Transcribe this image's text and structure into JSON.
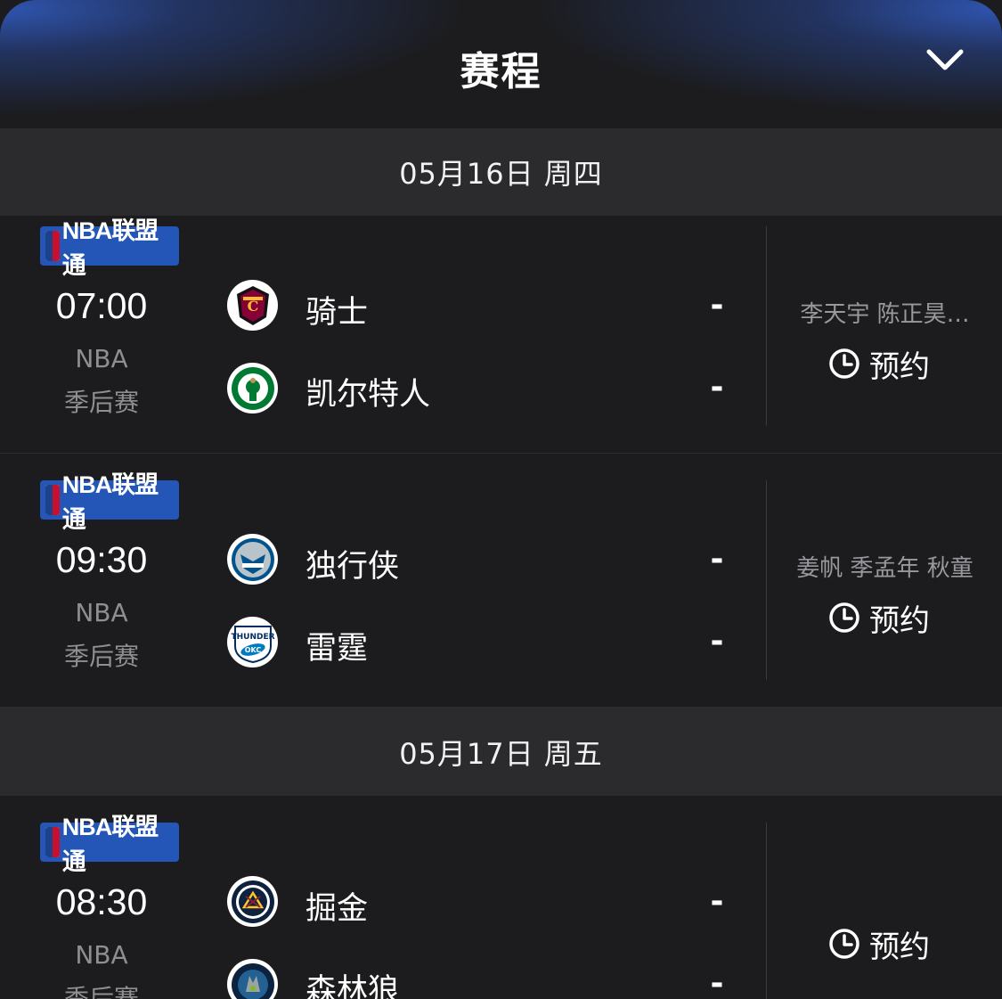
{
  "header": {
    "title": "赛程"
  },
  "days": [
    {
      "date": "05月16日 周四",
      "matches": [
        {
          "badge": "NBA联盟通",
          "time": "07:00",
          "league": "NBA",
          "stage": "季后赛",
          "home": {
            "name": "骑士",
            "score": "-",
            "logo_color": "#860038",
            "logo_accent": "#fdbb30",
            "logo_icon": "cavaliers-logo-icon"
          },
          "away": {
            "name": "凯尔特人",
            "score": "-",
            "logo_color": "#007a33",
            "logo_accent": "#ba9653",
            "logo_icon": "celtics-logo-icon"
          },
          "commentators": "李天宇 陈正昊…",
          "reserve_label": "预约"
        },
        {
          "badge": "NBA联盟通",
          "time": "09:30",
          "league": "NBA",
          "stage": "季后赛",
          "home": {
            "name": "独行侠",
            "score": "-",
            "logo_color": "#00538c",
            "logo_accent": "#b8c4ca",
            "logo_icon": "mavericks-logo-icon"
          },
          "away": {
            "name": "雷霆",
            "score": "-",
            "logo_color": "#007ac1",
            "logo_accent": "#ef3b24",
            "logo_icon": "thunder-logo-icon"
          },
          "commentators": "姜帆 季孟年 秋童",
          "reserve_label": "预约"
        }
      ]
    },
    {
      "date": "05月17日 周五",
      "matches": [
        {
          "badge": "NBA联盟通",
          "time": "08:30",
          "league": "NBA",
          "stage": "季后赛",
          "home": {
            "name": "掘金",
            "score": "-",
            "logo_color": "#0e2240",
            "logo_accent": "#fec524",
            "logo_icon": "nuggets-logo-icon"
          },
          "away": {
            "name": "森林狼",
            "score": "-",
            "logo_color": "#0c2340",
            "logo_accent": "#78be20",
            "logo_icon": "timberwolves-logo-icon"
          },
          "commentators": "",
          "reserve_label": "预约"
        }
      ]
    }
  ],
  "colors": {
    "background": "#1c1c1e",
    "date_bar": "#2b2b2d",
    "badge": "#2456b8",
    "header_glow": "#2f55b0"
  }
}
